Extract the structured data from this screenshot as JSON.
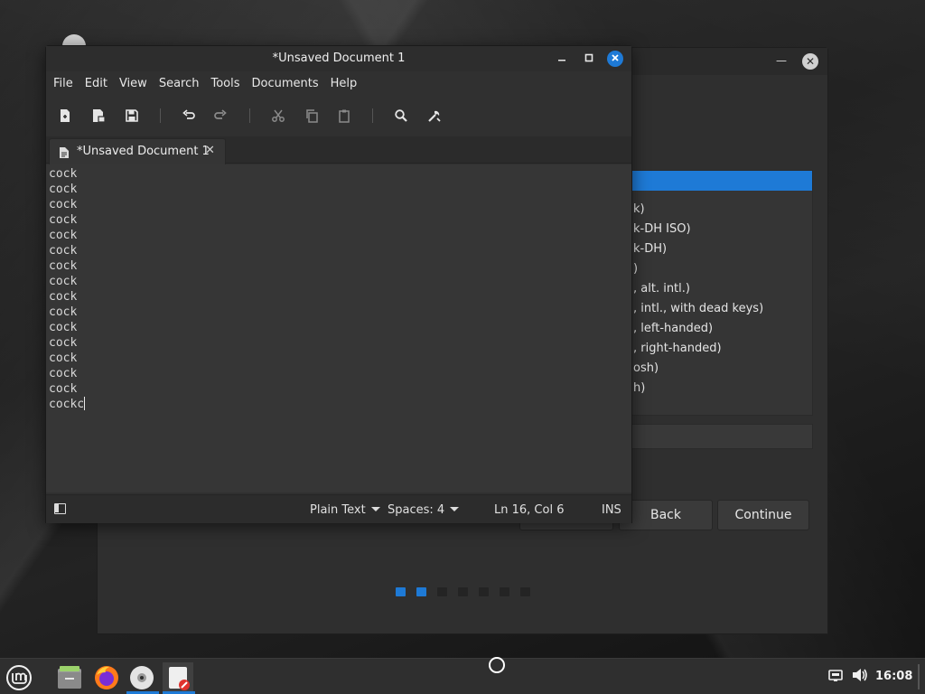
{
  "editor": {
    "title": "*Unsaved Document 1",
    "menu": [
      "File",
      "Edit",
      "View",
      "Search",
      "Tools",
      "Documents",
      "Help"
    ],
    "tab_label": "*Unsaved Document 1",
    "lines": [
      "cock",
      "cock",
      "cock",
      "cock",
      "cock",
      "cock",
      "cock",
      "cock",
      "cock",
      "cock",
      "cock",
      "cock",
      "cock",
      "cock",
      "cock",
      "cockc"
    ],
    "status": {
      "language": "Plain Text",
      "indent": "Spaces: 4",
      "position": "Ln 16, Col 6",
      "mode": "INS"
    },
    "toolbar_icons": [
      "new-document-icon",
      "open-document-icon",
      "save-icon",
      "undo-icon",
      "redo-icon",
      "cut-icon",
      "copy-icon",
      "paste-icon",
      "search-icon",
      "tools-icon"
    ]
  },
  "installer": {
    "layout_items": [
      "k)",
      "k-DH ISO)",
      "k-DH)",
      ")",
      ", alt. intl.)",
      ", intl., with dead keys)",
      ", left-handed)",
      ", right-handed)",
      "osh)",
      "h)"
    ],
    "buttons": {
      "back": "Back",
      "continue": "Continue"
    },
    "steps_total": 7,
    "steps_done": 2
  },
  "taskbar": {
    "clock": "16:08",
    "apps": [
      "mint-menu-icon",
      "file-manager-icon",
      "firefox-icon",
      "disc-installer-icon",
      "text-editor-icon"
    ]
  },
  "colors": {
    "accent": "#1e7ad6",
    "window_bg": "#303030",
    "text_area_bg": "#363636"
  }
}
